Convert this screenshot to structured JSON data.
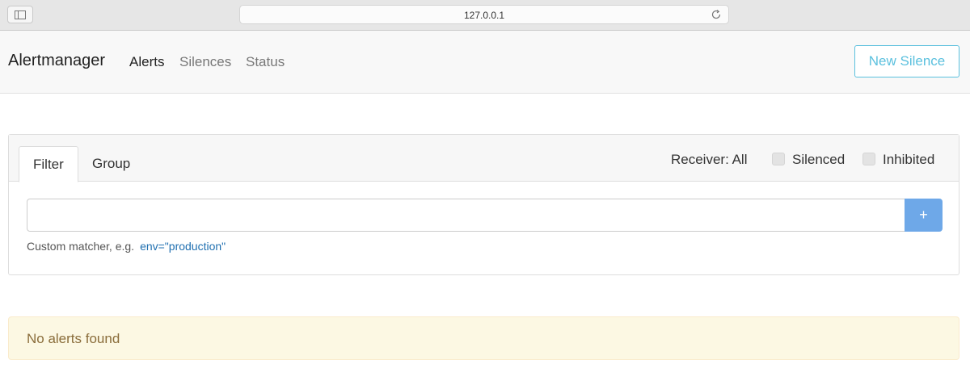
{
  "browser": {
    "url": "127.0.0.1",
    "icons": {
      "sidebar": "sidebar-icon",
      "reload": "reload-icon"
    }
  },
  "navbar": {
    "brand": "Alertmanager",
    "links": [
      {
        "label": "Alerts",
        "active": true
      },
      {
        "label": "Silences",
        "active": false
      },
      {
        "label": "Status",
        "active": false
      }
    ],
    "new_silence_label": "New Silence"
  },
  "filter": {
    "tabs": [
      {
        "label": "Filter",
        "active": true
      },
      {
        "label": "Group",
        "active": false
      }
    ],
    "receiver_label": "Receiver: All",
    "silenced_label": "Silenced",
    "inhibited_label": "Inhibited",
    "silenced_checked": false,
    "inhibited_checked": false,
    "input_value": "",
    "add_label": "+",
    "help_text": "Custom matcher, e.g.",
    "help_example": "env=\"production\""
  },
  "empty_message": "No alerts found",
  "colors": {
    "accent": "#5bc0de",
    "add_button": "#6ea8e8",
    "warning_bg": "#fcf8e3",
    "warning_text": "#8a6d3b",
    "link": "#1f6fb0"
  }
}
